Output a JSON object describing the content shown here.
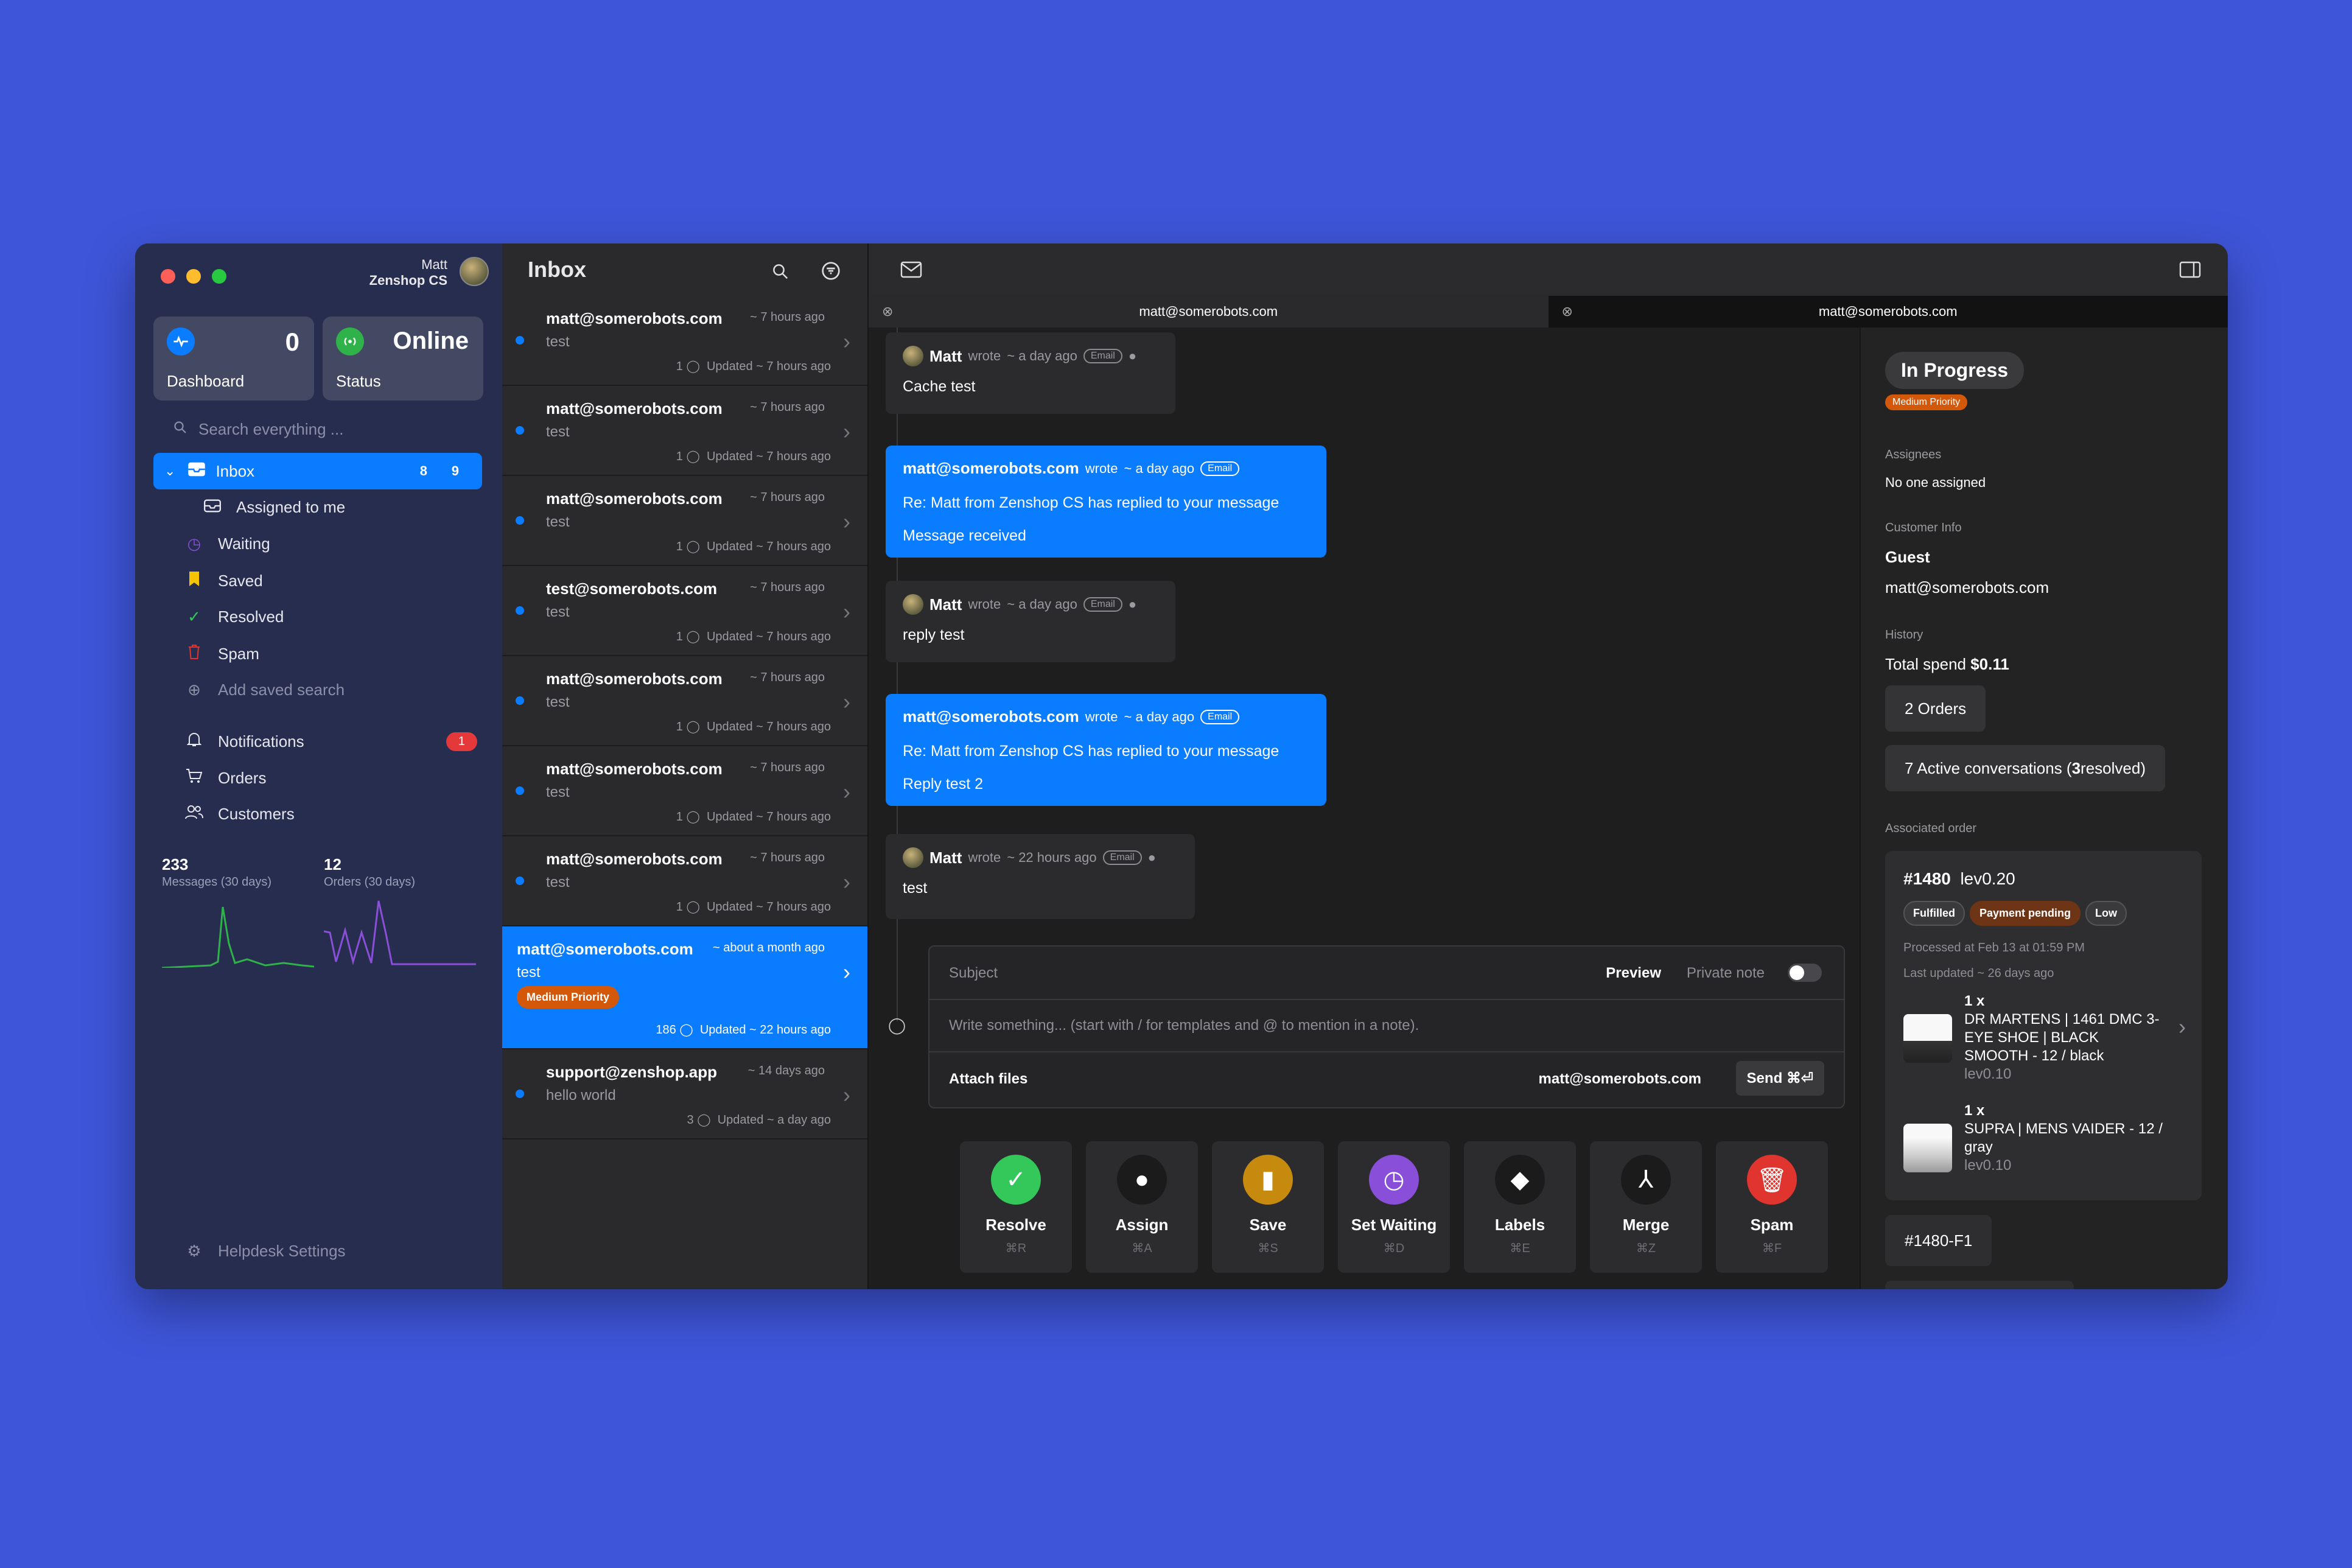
{
  "user": {
    "name": "Matt",
    "org": "Zenshop CS"
  },
  "cards": {
    "dashboard_value": "0",
    "dashboard_label": "Dashboard",
    "status_value": "Online",
    "status_label": "Status"
  },
  "search_placeholder": "Search everything ...",
  "nav": {
    "inbox": {
      "label": "Inbox",
      "count_a": "8",
      "count_b": "9"
    },
    "assigned": "Assigned to me",
    "waiting": "Waiting",
    "saved": "Saved",
    "resolved": "Resolved",
    "spam": "Spam",
    "add_saved": "Add saved search",
    "notifications": "Notifications",
    "notifications_count": "1",
    "orders": "Orders",
    "customers": "Customers",
    "settings": "Helpdesk Settings"
  },
  "stats": {
    "messages_value": "233",
    "messages_label": "Messages (30 days)",
    "orders_value": "12",
    "orders_label": "Orders (30 days)"
  },
  "list": {
    "title": "Inbox",
    "items": [
      {
        "from": "matt@somerobots.com",
        "ago": "~ 7 hours ago",
        "subject": "test",
        "count": "1",
        "updated": "Updated ~ 7 hours ago"
      },
      {
        "from": "matt@somerobots.com",
        "ago": "~ 7 hours ago",
        "subject": "test",
        "count": "1",
        "updated": "Updated ~ 7 hours ago"
      },
      {
        "from": "matt@somerobots.com",
        "ago": "~ 7 hours ago",
        "subject": "test",
        "count": "1",
        "updated": "Updated ~ 7 hours ago"
      },
      {
        "from": "test@somerobots.com",
        "ago": "~ 7 hours ago",
        "subject": "test",
        "count": "1",
        "updated": "Updated ~ 7 hours ago"
      },
      {
        "from": "matt@somerobots.com",
        "ago": "~ 7 hours ago",
        "subject": "test",
        "count": "1",
        "updated": "Updated ~ 7 hours ago"
      },
      {
        "from": "matt@somerobots.com",
        "ago": "~ 7 hours ago",
        "subject": "test",
        "count": "1",
        "updated": "Updated ~ 7 hours ago"
      },
      {
        "from": "matt@somerobots.com",
        "ago": "~ 7 hours ago",
        "subject": "test",
        "count": "1",
        "updated": "Updated ~ 7 hours ago"
      },
      {
        "from": "matt@somerobots.com",
        "ago": "~ about a month ago",
        "subject": "test",
        "tag": "Medium Priority",
        "count": "186",
        "updated": "Updated ~ 22 hours ago"
      },
      {
        "from": "support@zenshop.app",
        "ago": "~ 14 days ago",
        "subject": "hello world",
        "count": "3",
        "updated": "Updated ~ a day ago"
      }
    ]
  },
  "tabs": [
    "matt@somerobots.com",
    "matt@somerobots.com"
  ],
  "messages": [
    {
      "author": "Matt",
      "wrote": "wrote",
      "ago": "~ a day ago",
      "channel": "Email",
      "body": "Cache test"
    },
    {
      "author": "matt@somerobots.com",
      "wrote": "wrote",
      "ago": "~ a day ago",
      "channel": "Email",
      "line1": "Re: Matt from Zenshop CS has replied to your message",
      "line2": "Message received"
    },
    {
      "author": "Matt",
      "wrote": "wrote",
      "ago": "~ a day ago",
      "channel": "Email",
      "body": "reply test"
    },
    {
      "author": "matt@somerobots.com",
      "wrote": "wrote",
      "ago": "~ a day ago",
      "channel": "Email",
      "line1": "Re: Matt from Zenshop CS has replied to your message",
      "line2": "Reply test 2"
    },
    {
      "author": "Matt",
      "wrote": "wrote",
      "ago": "~ 22 hours ago",
      "channel": "Email",
      "body": "test"
    }
  ],
  "composer": {
    "subject_placeholder": "Subject",
    "preview": "Preview",
    "private_note": "Private note",
    "body_placeholder": "Write something... (start with / for templates and @ to mention in a note).",
    "attach": "Attach files",
    "to": "matt@somerobots.com",
    "send": "Send ⌘⏎"
  },
  "actions": [
    {
      "label": "Resolve",
      "key": "⌘R",
      "color": "#34c759",
      "icon": "check-icon"
    },
    {
      "label": "Assign",
      "key": "⌘A",
      "color": "#1b1b1c",
      "icon": "person-icon"
    },
    {
      "label": "Save",
      "key": "⌘S",
      "color": "#c68a0f",
      "icon": "bookmark-icon"
    },
    {
      "label": "Set Waiting",
      "key": "⌘D",
      "color": "#8a4fd8",
      "icon": "timer-icon"
    },
    {
      "label": "Labels",
      "key": "⌘E",
      "color": "#1b1b1c",
      "icon": "tag-icon"
    },
    {
      "label": "Merge",
      "key": "⌘Z",
      "color": "#1b1b1c",
      "icon": "merge-icon"
    },
    {
      "label": "Spam",
      "key": "⌘F",
      "color": "#e0342e",
      "icon": "trash-icon"
    }
  ],
  "details": {
    "status": "In Progress",
    "priority": "Medium Priority",
    "assignees_label": "Assignees",
    "assignees_value": "No one assigned",
    "customer_label": "Customer Info",
    "customer_name": "Guest",
    "customer_email": "matt@somerobots.com",
    "history_label": "History",
    "total_spend_label": "Total spend",
    "total_spend_value": "$0.11",
    "orders_btn": "2 Orders",
    "conversations_btn_prefix": "7 Active conversations (",
    "conversations_btn_bold": "3",
    "conversations_btn_suffix": " resolved)",
    "associated_label": "Associated order",
    "order_id": "#1480",
    "order_store": "lev0.20",
    "badges": [
      "Fulfilled",
      "Payment pending",
      "Low"
    ],
    "processed": "Processed at Feb 13 at 01:59 PM",
    "last_updated": "Last updated ~ 26 days ago",
    "lines": [
      {
        "qty": "1 x",
        "name": "DR MARTENS | 1461 DMC 3-EYE SHOE | BLACK SMOOTH - 12 / black",
        "store": "lev0.10"
      },
      {
        "qty": "1 x",
        "name": "SUPRA | MENS VAIDER - 12 / gray",
        "store": "lev0.10"
      }
    ],
    "fulfillment": "#1480-F1"
  }
}
